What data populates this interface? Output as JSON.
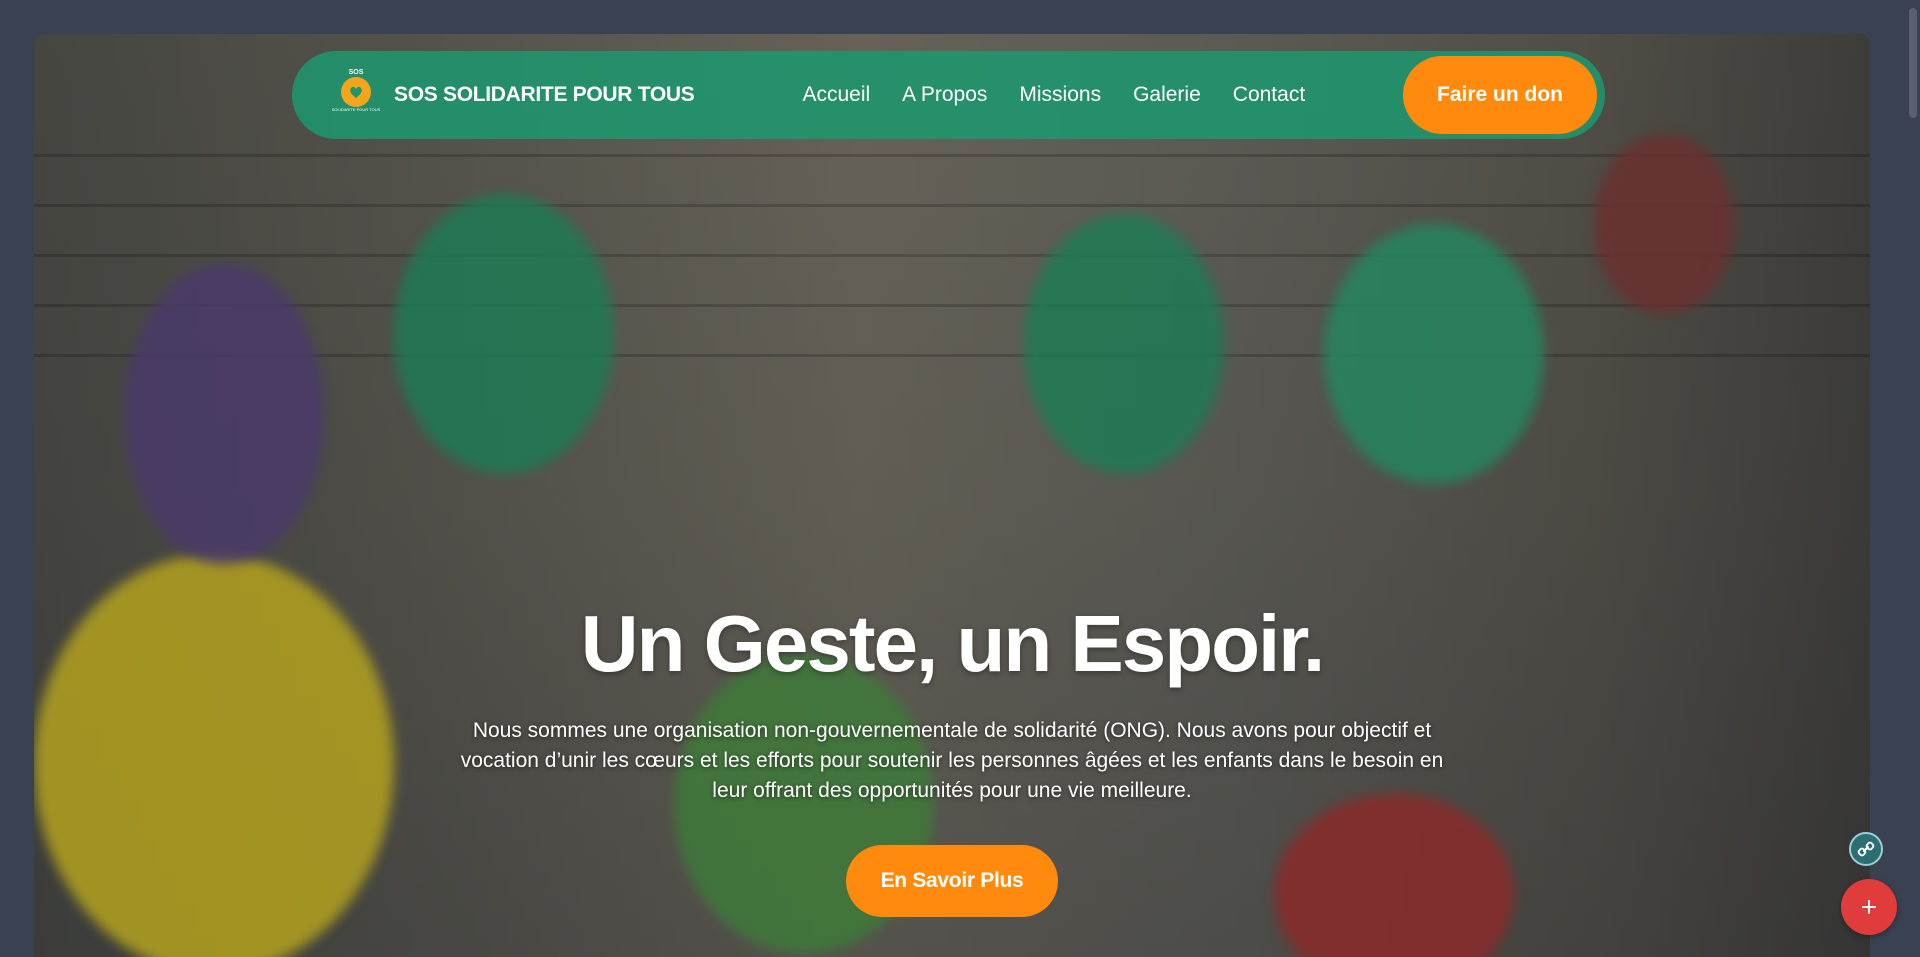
{
  "navbar": {
    "logo_top_text": "SOS",
    "logo_bottom_text": "SOLIDARITE POUR TOUS",
    "brand": "SOS SOLIDARITE POUR TOUS",
    "links": [
      "Accueil",
      "A Propos",
      "Missions",
      "Galerie",
      "Contact"
    ],
    "donate_label": "Faire un don"
  },
  "hero": {
    "title": "Un Geste, un Espoir.",
    "description": "Nous sommes une organisation non-gouvernementale de solidarité (ONG). Nous avons pour objectif et vocation d’unir les cœurs et les efforts pour soutenir les personnes âgées et les enfants dans le besoin en leur offrant des opportunités pour une vie meilleure.",
    "cta_label": "En Savoir Plus"
  },
  "floating": {
    "small_icon": "link-icon",
    "plus_icon": "plus-icon"
  },
  "colors": {
    "navbar_green": "#1e966e",
    "accent_orange": "#ff8a0d",
    "fab_red": "#e03c3c",
    "page_background": "#3a4150"
  }
}
